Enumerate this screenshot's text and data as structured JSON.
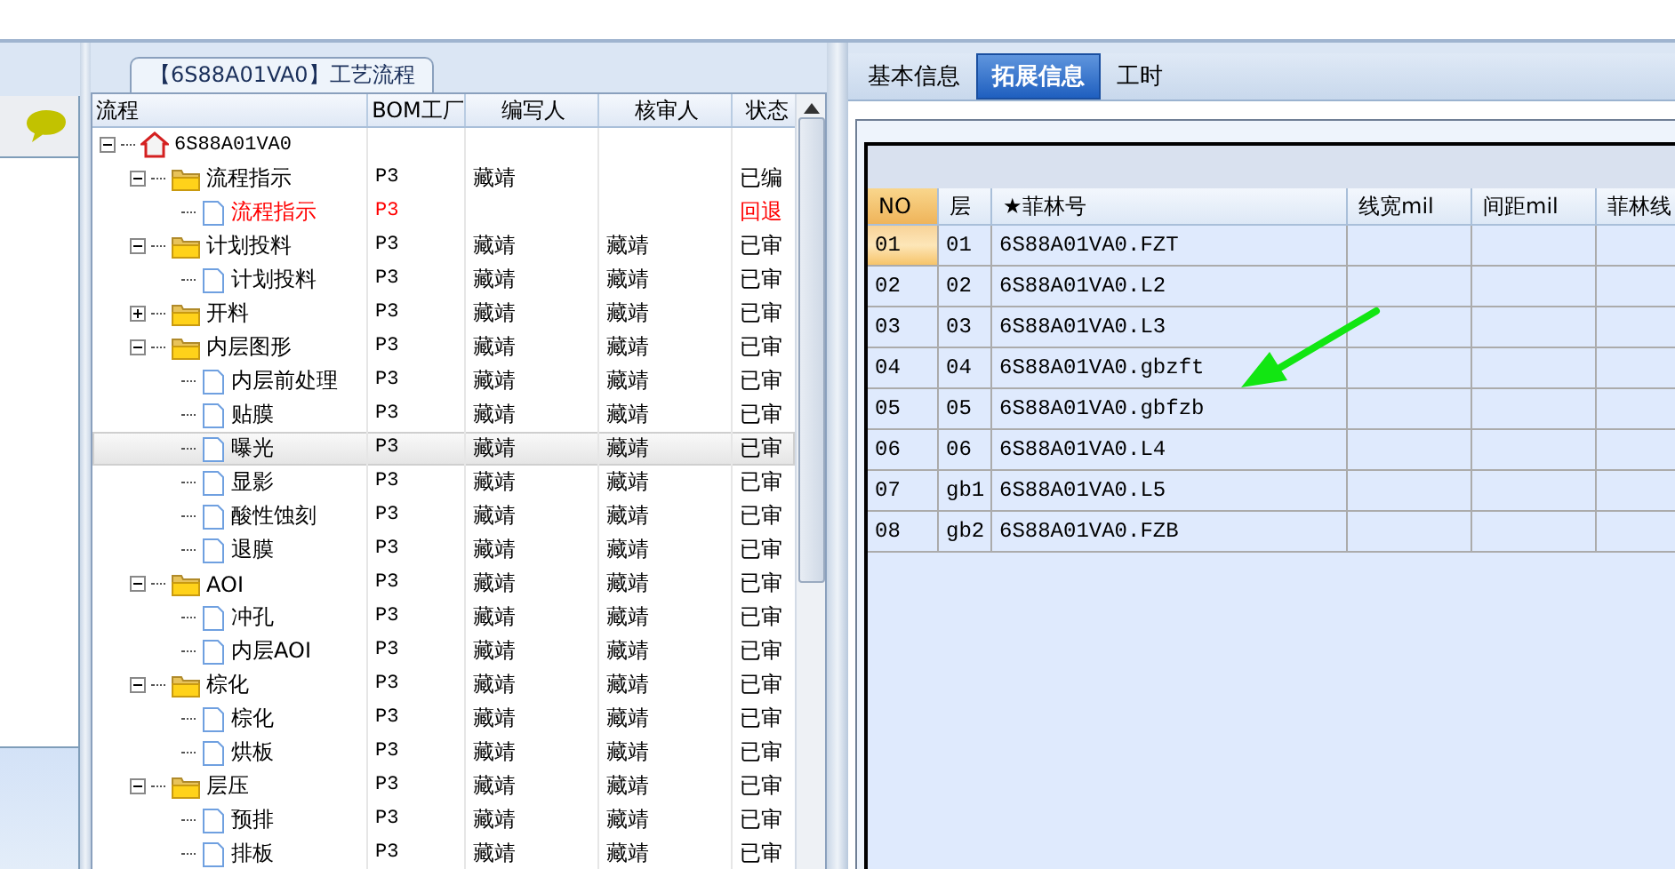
{
  "left_panel": {
    "kind": "chat"
  },
  "process_group": {
    "title": "【6S88A01VA0】工艺流程",
    "columns": [
      "流程",
      "BOM工厂",
      "编写人",
      "核审人",
      "状态"
    ],
    "tree": [
      {
        "kind": "root",
        "name": "6S88A01VA0",
        "expanded": true,
        "children": [
          {
            "kind": "folder",
            "name": "流程指示",
            "bom": "P3",
            "writer": "藏靖",
            "status": "已编",
            "expanded": true,
            "children": [
              {
                "kind": "doc",
                "name": "流程指示",
                "bom": "P3",
                "status": "回退",
                "returned": true,
                "selected": false
              }
            ]
          },
          {
            "kind": "folder",
            "name": "计划投料",
            "bom": "P3",
            "writer": "藏靖",
            "reviewer": "藏靖",
            "status": "已审",
            "expanded": true,
            "children": [
              {
                "kind": "doc",
                "name": "计划投料",
                "bom": "P3",
                "writer": "藏靖",
                "reviewer": "藏靖",
                "status": "已审",
                "returned": false,
                "selected": false
              }
            ]
          },
          {
            "kind": "folder",
            "name": "开料",
            "bom": "P3",
            "writer": "藏靖",
            "reviewer": "藏靖",
            "status": "已审",
            "expanded": false
          },
          {
            "kind": "folder",
            "name": "内层图形",
            "bom": "P3",
            "writer": "藏靖",
            "reviewer": "藏靖",
            "status": "已审",
            "expanded": true,
            "children": [
              {
                "kind": "doc",
                "name": "内层前处理",
                "bom": "P3",
                "writer": "藏靖",
                "reviewer": "藏靖",
                "status": "已审",
                "returned": false,
                "selected": false
              },
              {
                "kind": "doc",
                "name": "贴膜",
                "bom": "P3",
                "writer": "藏靖",
                "reviewer": "藏靖",
                "status": "已审",
                "returned": false,
                "selected": false
              },
              {
                "kind": "doc",
                "name": "曝光",
                "bom": "P3",
                "writer": "藏靖",
                "reviewer": "藏靖",
                "status": "已审",
                "returned": false,
                "selected": true
              },
              {
                "kind": "doc",
                "name": "显影",
                "bom": "P3",
                "writer": "藏靖",
                "reviewer": "藏靖",
                "status": "已审",
                "returned": false,
                "selected": false
              },
              {
                "kind": "doc",
                "name": "酸性蚀刻",
                "bom": "P3",
                "writer": "藏靖",
                "reviewer": "藏靖",
                "status": "已审",
                "returned": false,
                "selected": false
              },
              {
                "kind": "doc",
                "name": "退膜",
                "bom": "P3",
                "writer": "藏靖",
                "reviewer": "藏靖",
                "status": "已审",
                "returned": false,
                "selected": false
              }
            ]
          },
          {
            "kind": "folder",
            "name": "AOI",
            "bom": "P3",
            "writer": "藏靖",
            "reviewer": "藏靖",
            "status": "已审",
            "expanded": true,
            "children": [
              {
                "kind": "doc",
                "name": "冲孔",
                "bom": "P3",
                "writer": "藏靖",
                "reviewer": "藏靖",
                "status": "已审",
                "returned": false,
                "selected": false
              },
              {
                "kind": "doc",
                "name": "内层AOI",
                "bom": "P3",
                "writer": "藏靖",
                "reviewer": "藏靖",
                "status": "已审",
                "returned": false,
                "selected": false
              }
            ]
          },
          {
            "kind": "folder",
            "name": "棕化",
            "bom": "P3",
            "writer": "藏靖",
            "reviewer": "藏靖",
            "status": "已审",
            "expanded": true,
            "children": [
              {
                "kind": "doc",
                "name": "棕化",
                "bom": "P3",
                "writer": "藏靖",
                "reviewer": "藏靖",
                "status": "已审",
                "returned": false,
                "selected": false
              },
              {
                "kind": "doc",
                "name": "烘板",
                "bom": "P3",
                "writer": "藏靖",
                "reviewer": "藏靖",
                "status": "已审",
                "returned": false,
                "selected": false
              }
            ]
          },
          {
            "kind": "folder",
            "name": "层压",
            "bom": "P3",
            "writer": "藏靖",
            "reviewer": "藏靖",
            "status": "已审",
            "expanded": true,
            "children": [
              {
                "kind": "doc",
                "name": "预排",
                "bom": "P3",
                "writer": "藏靖",
                "reviewer": "藏靖",
                "status": "已审",
                "returned": false,
                "selected": false
              },
              {
                "kind": "doc",
                "name": "排板",
                "bom": "P3",
                "writer": "藏靖",
                "reviewer": "藏靖",
                "status": "已审",
                "returned": false,
                "selected": false
              }
            ]
          }
        ]
      }
    ]
  },
  "tabs": [
    {
      "label": "基本信息",
      "selected": false
    },
    {
      "label": "拓展信息",
      "selected": true
    },
    {
      "label": "工时",
      "selected": false
    }
  ],
  "film_table": {
    "columns": [
      "NO",
      "层",
      "★菲林号",
      "线宽mil",
      "间距mil",
      "菲林线"
    ],
    "rows": [
      {
        "no": "01",
        "layer": "01",
        "film": "6S88A01VA0.FZT",
        "selected": true
      },
      {
        "no": "02",
        "layer": "02",
        "film": "6S88A01VA0.L2",
        "selected": false
      },
      {
        "no": "03",
        "layer": "03",
        "film": "6S88A01VA0.L3",
        "selected": false
      },
      {
        "no": "04",
        "layer": "04",
        "film": "6S88A01VA0.gbzft",
        "selected": false
      },
      {
        "no": "05",
        "layer": "05",
        "film": "6S88A01VA0.gbfzb",
        "selected": false
      },
      {
        "no": "06",
        "layer": "06",
        "film": "6S88A01VA0.L4",
        "selected": false
      },
      {
        "no": "07",
        "layer": "gb1",
        "film": "6S88A01VA0.L5",
        "selected": false
      },
      {
        "no": "08",
        "layer": "gb2",
        "film": "6S88A01VA0.FZB",
        "selected": false
      }
    ]
  },
  "annotation": {
    "kind": "arrow"
  }
}
